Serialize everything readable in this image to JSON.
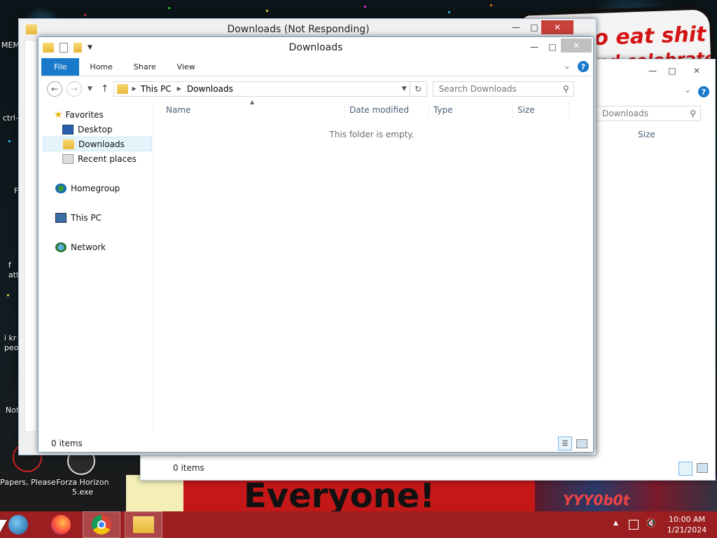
{
  "desktop": {
    "sign_text_1": "to eat shit",
    "sign_text_2": "and celebrate",
    "banner_text": "Everyone!",
    "crowd_text": "YYY0b0t",
    "icons": [
      {
        "label": "MEM"
      },
      {
        "label": "ctrl-"
      },
      {
        "label": "F"
      },
      {
        "label": "f att"
      },
      {
        "label": "i kr peo"
      },
      {
        "label": "Not"
      },
      {
        "label": "Papers, Please"
      },
      {
        "label": "Forza Horizon 5.exe"
      }
    ]
  },
  "back_window": {
    "search_placeholder": "Downloads",
    "size_header": "Size",
    "status": "0 items"
  },
  "mid_window": {
    "title": "Downloads (Not Responding)"
  },
  "front_window": {
    "title": "Downloads",
    "ribbon_tabs": [
      "File",
      "Home",
      "Share",
      "View"
    ],
    "address": {
      "crumbs": [
        "This PC",
        "Downloads"
      ]
    },
    "search_placeholder": "Search Downloads",
    "nav": {
      "favorites": "Favorites",
      "desktop": "Desktop",
      "downloads": "Downloads",
      "recent": "Recent places",
      "homegroup": "Homegroup",
      "thispc": "This PC",
      "network": "Network"
    },
    "columns": [
      "Name",
      "Date modified",
      "Type",
      "Size"
    ],
    "empty_message": "This folder is empty.",
    "status": "0 items"
  },
  "taskbar": {
    "time": "10:00 AM",
    "date": "1/21/2024"
  },
  "colors": {
    "taskbar": "#9b1e20",
    "file_tab": "#1979ca",
    "close_button": "#c7403a"
  }
}
